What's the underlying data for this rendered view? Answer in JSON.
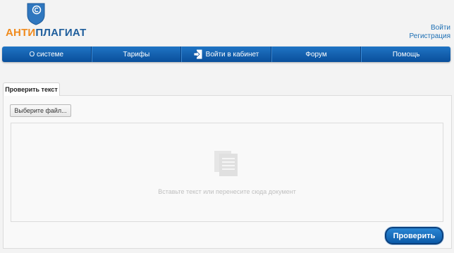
{
  "brand": {
    "part1": "АНТИ",
    "part2": "ПЛАГИАТ"
  },
  "auth": {
    "login": "Войти",
    "register": "Регистрация"
  },
  "nav": {
    "items": [
      "О системе",
      "Тарифы",
      "Войти в кабинет",
      "Форум",
      "Помощь"
    ]
  },
  "tab": {
    "label": "Проверить текст"
  },
  "form": {
    "file_button": "Выберите файл...",
    "drop_placeholder": "Вставьте текст или перенесите сюда документ",
    "submit": "Проверить"
  },
  "colors": {
    "accent": "#0b5aa8",
    "brand_orange": "#f08a1c",
    "brand_blue": "#1f5e9c"
  },
  "icons": {
    "logo": "shield-copyright-icon",
    "login": "login-arrow-icon",
    "document": "document-stack-icon"
  }
}
